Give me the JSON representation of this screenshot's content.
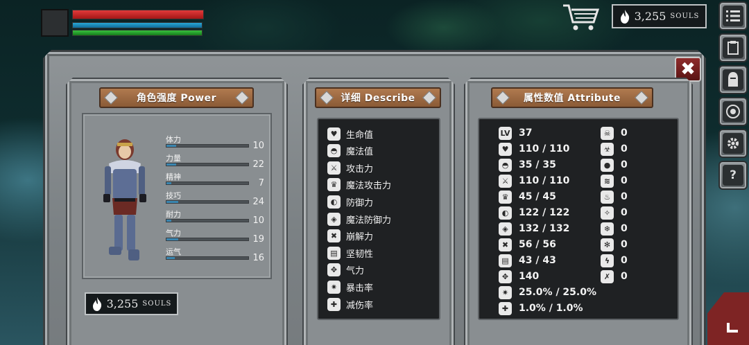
{
  "hud": {
    "top_souls": {
      "value": "3,255",
      "unit": "SOULS"
    },
    "side_buttons": [
      "menu-icon",
      "inventory-icon",
      "armor-icon",
      "skills-icon",
      "settings-icon",
      "help-icon"
    ],
    "help_label": "?"
  },
  "panels": {
    "power_title": "角色强度 Power",
    "describe_title": "详细 Describe",
    "attribute_title": "属性数值 Attribute"
  },
  "power": {
    "stats": [
      {
        "label": "体力",
        "value": "10",
        "fill": 0.12
      },
      {
        "label": "力量",
        "value": "22",
        "fill": 0.12
      },
      {
        "label": "精神",
        "value": "7",
        "fill": 0.06
      },
      {
        "label": "技巧",
        "value": "24",
        "fill": 0.14
      },
      {
        "label": "耐力",
        "value": "10",
        "fill": 0.06
      },
      {
        "label": "气力",
        "value": "19",
        "fill": 0.14
      },
      {
        "label": "运气",
        "value": "16",
        "fill": 0.1
      }
    ],
    "souls": {
      "value": "3,255",
      "unit": "SOULS"
    }
  },
  "describe": {
    "rows": [
      {
        "icon": "heart-icon",
        "label": "生命值"
      },
      {
        "icon": "helmet-icon",
        "label": "魔法值"
      },
      {
        "icon": "sword-icon",
        "label": "攻击力"
      },
      {
        "icon": "crown-icon",
        "label": "魔法攻击力"
      },
      {
        "icon": "shield-icon",
        "label": "防御力"
      },
      {
        "icon": "magic-shield-icon",
        "label": "魔法防御力"
      },
      {
        "icon": "break-icon",
        "label": "崩解力"
      },
      {
        "icon": "knight-helm-icon",
        "label": "坚韧性"
      },
      {
        "icon": "lungs-icon",
        "label": "气力"
      },
      {
        "icon": "star-burst-icon",
        "label": "暴击率"
      },
      {
        "icon": "shield-plus-icon",
        "label": "减伤率"
      }
    ]
  },
  "attribute": {
    "left": [
      {
        "icon": "level-icon",
        "icon_text": "LV",
        "value": "37"
      },
      {
        "icon": "heart-icon",
        "icon_text": "",
        "value": "110 / 110"
      },
      {
        "icon": "helmet-icon",
        "icon_text": "",
        "value": "35 / 35"
      },
      {
        "icon": "sword-icon",
        "icon_text": "",
        "value": "110 / 110"
      },
      {
        "icon": "crown-icon",
        "icon_text": "",
        "value": "45 / 45"
      },
      {
        "icon": "shield-icon",
        "icon_text": "",
        "value": "122 / 122"
      },
      {
        "icon": "magic-shield-icon",
        "icon_text": "",
        "value": "132 / 132"
      },
      {
        "icon": "break-icon",
        "icon_text": "",
        "value": "56 / 56"
      },
      {
        "icon": "knight-helm-icon",
        "icon_text": "",
        "value": "43 / 43"
      },
      {
        "icon": "lungs-icon",
        "icon_text": "",
        "value": "140"
      },
      {
        "icon": "star-burst-icon",
        "icon_text": "",
        "value": "25.0% / 25.0%"
      },
      {
        "icon": "shield-plus-icon",
        "icon_text": "",
        "value": "1.0% / 1.0%"
      }
    ],
    "right": [
      {
        "icon": "skull-icon",
        "value": "0"
      },
      {
        "icon": "poison-icon",
        "value": "0"
      },
      {
        "icon": "bleed-icon",
        "value": "0"
      },
      {
        "icon": "scratch-icon",
        "value": "0"
      },
      {
        "icon": "fire-icon",
        "value": "0"
      },
      {
        "icon": "burn-icon",
        "value": "0"
      },
      {
        "icon": "frost-icon",
        "value": "0"
      },
      {
        "icon": "snowflake-icon",
        "value": "0"
      },
      {
        "icon": "lightning-icon",
        "value": "0"
      },
      {
        "icon": "crossed-swords-icon",
        "value": "0"
      }
    ]
  }
}
